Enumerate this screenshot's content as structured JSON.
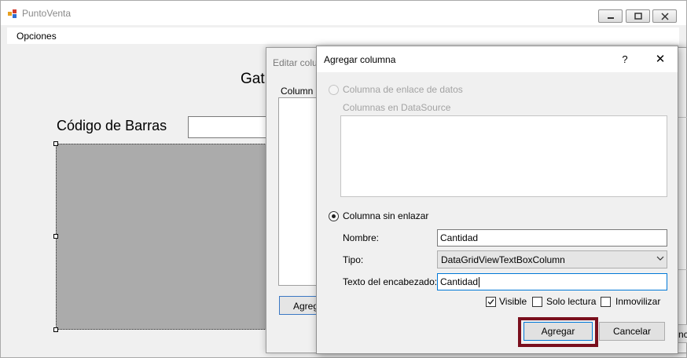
{
  "main_window": {
    "title": "PuntoVenta",
    "menu": [
      "Opciones"
    ],
    "heading_fragment": "Gat",
    "barcode_label": "Código de Barras"
  },
  "edit_dialog": {
    "title_fragment": "Editar colu",
    "columns_label_fragment": "Column",
    "add_button_fragment": "Agreg",
    "cancel_button_fragment": "nce"
  },
  "add_dialog": {
    "title": "Agregar columna",
    "help": "?",
    "close": "✕",
    "bound_option": "Columna de enlace de datos",
    "datasource_label": "Columnas en DataSource",
    "unbound_option": "Columna sin enlazar",
    "name_label": "Nombre:",
    "name_value": "Cantidad",
    "type_label": "Tipo:",
    "type_value": "DataGridViewTextBoxColumn",
    "header_label": "Texto del encabezado:",
    "header_value": "Cantidad",
    "checkboxes": [
      {
        "label": "Visible",
        "checked": true
      },
      {
        "label": "Solo lectura",
        "checked": false
      },
      {
        "label": "Inmovilizar",
        "checked": false
      }
    ],
    "agregar_button": "Agregar",
    "cancelar_button": "Cancelar"
  },
  "colors": {
    "highlight": "#7a0f1d",
    "focus": "#0078d7",
    "grid_bg": "#ababab"
  }
}
